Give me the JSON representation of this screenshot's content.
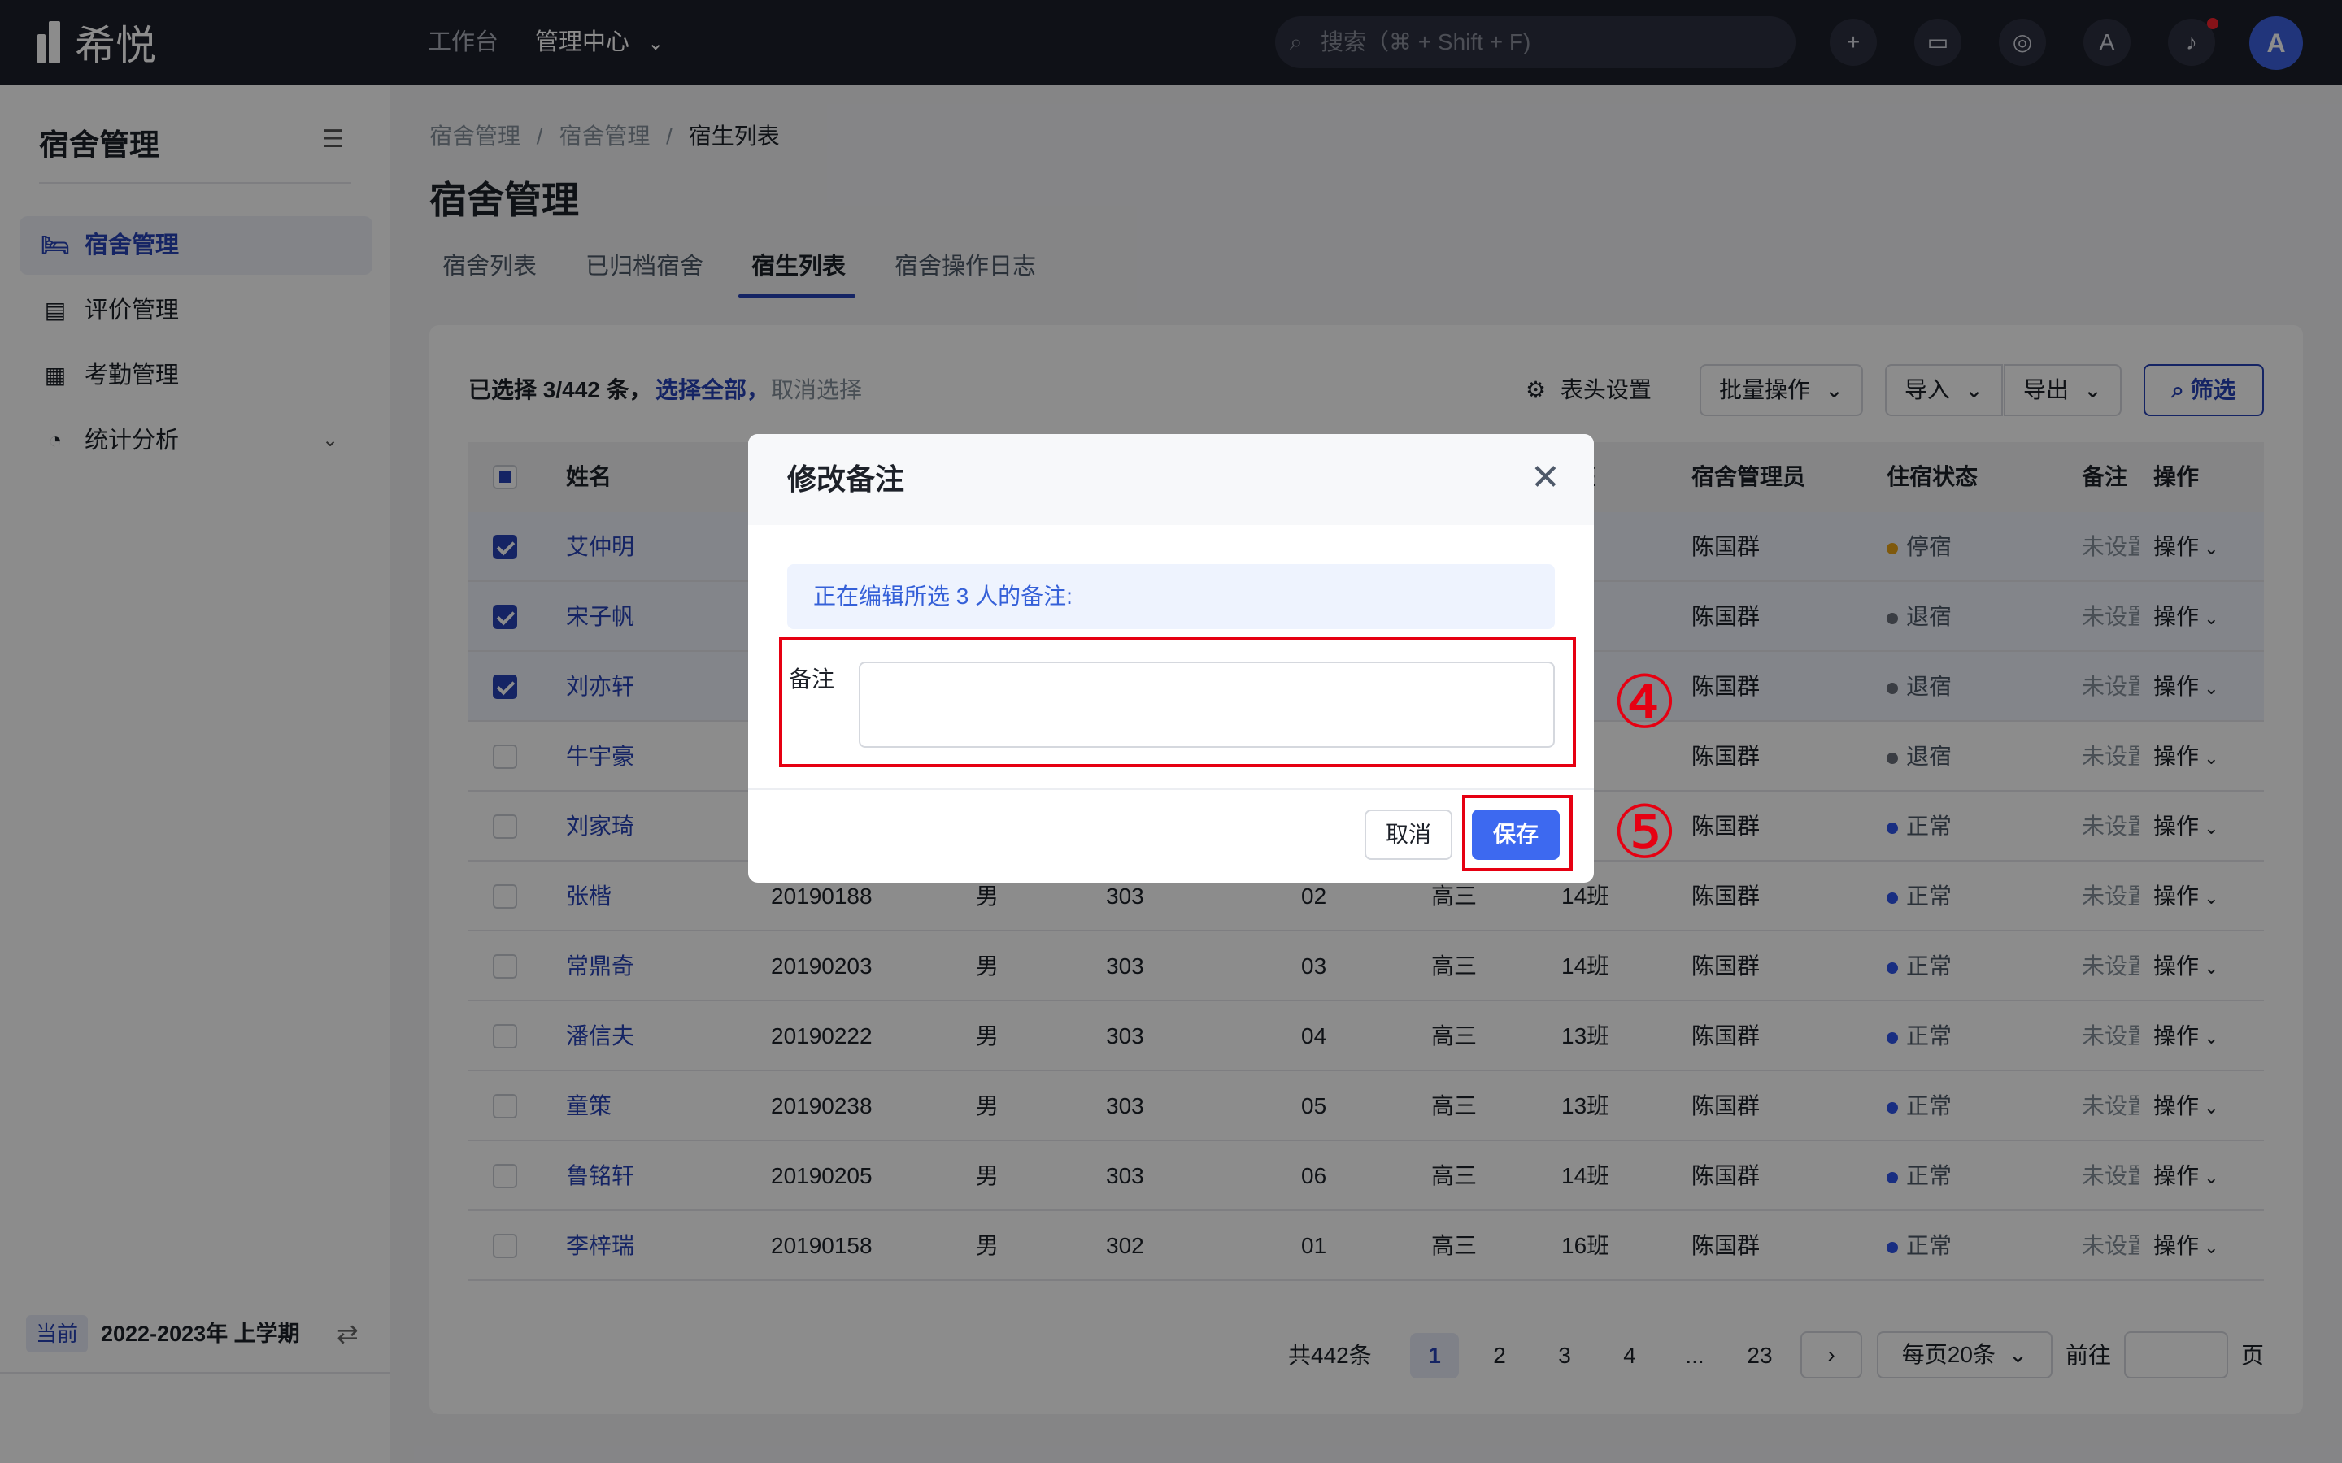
{
  "topbar": {
    "brand": "希悦",
    "nav": [
      "工作台",
      "管理中心"
    ],
    "search_placeholder": "搜索（⌘ + Shift + F)",
    "avatar_letter": "A"
  },
  "sidebar": {
    "title": "宿舍管理",
    "items": [
      {
        "label": "宿舍管理",
        "icon": "bed-icon"
      },
      {
        "label": "评价管理",
        "icon": "rating-doc-icon"
      },
      {
        "label": "考勤管理",
        "icon": "calendar-icon"
      },
      {
        "label": "统计分析",
        "icon": "pie-chart-icon"
      }
    ],
    "term_badge": "当前",
    "term": "2022-2023年 上学期"
  },
  "breadcrumb": [
    "宿舍管理",
    "宿舍管理",
    "宿生列表"
  ],
  "page_title": "宿舍管理",
  "tabs": [
    "宿舍列表",
    "已归档宿舍",
    "宿生列表",
    "宿舍操作日志"
  ],
  "toolbar": {
    "selected": "已选择 3/442 条，",
    "select_all": "选择全部，",
    "cancel_select": "取消选择",
    "header_settings": "表头设置",
    "batch": "批量操作",
    "import": "导入",
    "export": "导出",
    "filter": "筛选"
  },
  "table": {
    "headers": {
      "name": "姓名",
      "cls": "教班",
      "manager": "宿舍管理员",
      "status": "住宿状态",
      "note": "备注",
      "op": "操作"
    },
    "rows": [
      {
        "name": "艾仲明",
        "id": "",
        "gender": "",
        "room": "",
        "bed": "",
        "grade": "",
        "cls": "班",
        "manager": "陈国群",
        "status": "停宿",
        "note": "未设置",
        "op": "操作",
        "selected": true
      },
      {
        "name": "宋子帆",
        "id": "",
        "gender": "",
        "room": "",
        "bed": "",
        "grade": "",
        "cls": "班",
        "manager": "陈国群",
        "status": "退宿",
        "note": "未设置",
        "op": "操作",
        "selected": true
      },
      {
        "name": "刘亦轩",
        "id": "",
        "gender": "",
        "room": "",
        "bed": "",
        "grade": "",
        "cls": "班",
        "manager": "陈国群",
        "status": "退宿",
        "note": "未设置",
        "op": "操作",
        "selected": true
      },
      {
        "name": "牛宇豪",
        "id": "",
        "gender": "",
        "room": "",
        "bed": "",
        "grade": "",
        "cls": "班",
        "manager": "陈国群",
        "status": "退宿",
        "note": "未设置",
        "op": "操作",
        "selected": false
      },
      {
        "name": "刘家琦",
        "id": "",
        "gender": "",
        "room": "",
        "bed": "",
        "grade": "",
        "cls": "班",
        "manager": "陈国群",
        "status": "正常",
        "note": "未设置",
        "op": "操作",
        "selected": false
      },
      {
        "name": "张楷",
        "id": "20190188",
        "gender": "男",
        "room": "303",
        "bed": "02",
        "grade": "高三",
        "cls": "14班",
        "manager": "陈国群",
        "status": "正常",
        "note": "未设置",
        "op": "操作",
        "selected": false
      },
      {
        "name": "常鼎奇",
        "id": "20190203",
        "gender": "男",
        "room": "303",
        "bed": "03",
        "grade": "高三",
        "cls": "14班",
        "manager": "陈国群",
        "status": "正常",
        "note": "未设置",
        "op": "操作",
        "selected": false
      },
      {
        "name": "潘信夫",
        "id": "20190222",
        "gender": "男",
        "room": "303",
        "bed": "04",
        "grade": "高三",
        "cls": "13班",
        "manager": "陈国群",
        "status": "正常",
        "note": "未设置",
        "op": "操作",
        "selected": false
      },
      {
        "name": "童策",
        "id": "20190238",
        "gender": "男",
        "room": "303",
        "bed": "05",
        "grade": "高三",
        "cls": "13班",
        "manager": "陈国群",
        "status": "正常",
        "note": "未设置",
        "op": "操作",
        "selected": false
      },
      {
        "name": "鲁铭轩",
        "id": "20190205",
        "gender": "男",
        "room": "303",
        "bed": "06",
        "grade": "高三",
        "cls": "14班",
        "manager": "陈国群",
        "status": "正常",
        "note": "未设置",
        "op": "操作",
        "selected": false
      },
      {
        "name": "李梓瑞",
        "id": "20190158",
        "gender": "男",
        "room": "302",
        "bed": "01",
        "grade": "高三",
        "cls": "16班",
        "manager": "陈国群",
        "status": "正常",
        "note": "未设置",
        "op": "操作",
        "selected": false
      }
    ]
  },
  "status_colors": {
    "停宿": "#e8a317",
    "退宿": "#6b6f7a",
    "正常": "#2f54eb"
  },
  "pagination": {
    "total": "共442条",
    "pages": [
      "1",
      "2",
      "3",
      "4",
      "...",
      "23"
    ],
    "per_page": "每页20条",
    "goto": "前往",
    "page_unit": "页"
  },
  "modal": {
    "title": "修改备注",
    "info": "正在编辑所选 3 人的备注:",
    "label": "备注",
    "cancel": "取消",
    "save": "保存"
  },
  "annotations": [
    "④",
    "⑤"
  ]
}
